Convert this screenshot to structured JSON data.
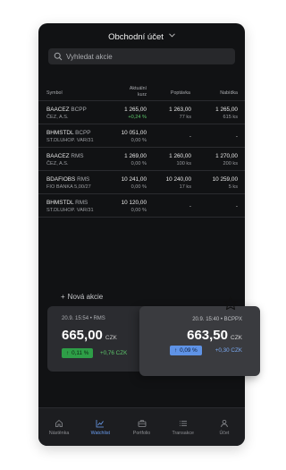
{
  "header": {
    "title": "Obchodní účet",
    "chevron_icon": "chevron-down-icon"
  },
  "search": {
    "placeholder": "Vyhledat akcie",
    "icon": "search-icon"
  },
  "table": {
    "columns": {
      "symbol": "Symbol",
      "rate_line1": "Aktuální",
      "rate_line2": "kurz",
      "bid": "Poptávka",
      "ask": "Nabídka"
    },
    "rows": [
      {
        "symbol": "BAACEZ",
        "market": "BCPP",
        "name": "ČEZ, A.S.",
        "price": "1 265,00",
        "change": "+0,24 %",
        "change_up": true,
        "bid": "1 263,00",
        "bid_qty": "77 ks",
        "ask": "1 265,00",
        "ask_qty": "615 ks"
      },
      {
        "symbol": "BHMSTDL",
        "market": "BCPP",
        "name": "ST.DLUHOP. VAR/31",
        "price": "10 051,00",
        "change": "0,00 %",
        "change_up": false,
        "bid": "-",
        "bid_qty": "",
        "ask": "-",
        "ask_qty": ""
      },
      {
        "symbol": "BAACEZ",
        "market": "RMS",
        "name": "ČEZ, A.S.",
        "price": "1 269,00",
        "change": "0,00 %",
        "change_up": false,
        "bid": "1 260,00",
        "bid_qty": "100 ks",
        "ask": "1 270,00",
        "ask_qty": "200 ks"
      },
      {
        "symbol": "BDAFIOBS",
        "market": "RMS",
        "name": "FIO BANKA 5,00/27",
        "price": "10 241,00",
        "change": "0,00 %",
        "change_up": false,
        "bid": "10 240,00",
        "bid_qty": "17 ks",
        "ask": "10 259,00",
        "ask_qty": "5 ks"
      },
      {
        "symbol": "BHMSTDL",
        "market": "RMS",
        "name": "ST.DLUHOP. VAR/31",
        "price": "10 120,00",
        "change": "0,00 %",
        "change_up": false,
        "bid": "-",
        "bid_qty": "",
        "ask": "-",
        "ask_qty": ""
      }
    ]
  },
  "add_stock": {
    "label": "Nová akcie",
    "icon": "plus-icon"
  },
  "quote_card": {
    "meta": "20.9. 15:54 • RMS",
    "price": "665,00",
    "currency": "CZK",
    "badge": "0,11 %",
    "delta": "+0,76 CZK",
    "accent": "#2e9e47"
  },
  "quote_card_overlay": {
    "meta": "20.9. 15:40 • BCPPX",
    "price": "663,50",
    "currency": "CZK",
    "badge": "0,09 %",
    "delta": "+0,30 CZK",
    "accent": "#5f93e6"
  },
  "favorite_icon": "star-icon",
  "nav": {
    "items": [
      {
        "label": "Nástěnka",
        "icon": "home-icon",
        "active": false
      },
      {
        "label": "Watchlist",
        "icon": "chart-icon",
        "active": true
      },
      {
        "label": "Portfolio",
        "icon": "briefcase-icon",
        "active": false
      },
      {
        "label": "Transakce",
        "icon": "list-icon",
        "active": false
      },
      {
        "label": "Účet",
        "icon": "user-icon",
        "active": false
      }
    ],
    "active_color": "#6b9ef0"
  }
}
